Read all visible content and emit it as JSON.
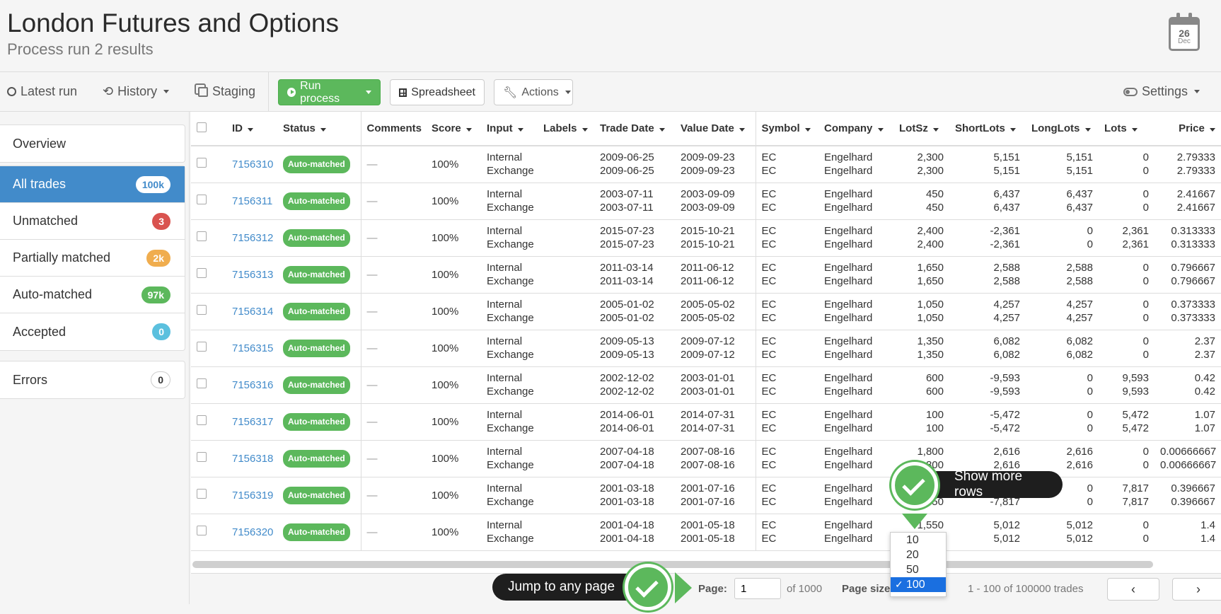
{
  "header": {
    "title": "London Futures and Options",
    "subtitle": "Process run 2 results",
    "calendar": {
      "day": "26",
      "month": "Dec"
    }
  },
  "toolbar": {
    "latest_run": "Latest run",
    "history": "History",
    "staging": "Staging",
    "run_process": "Run process",
    "spreadsheet": "Spreadsheet",
    "actions": "Actions",
    "settings": "Settings"
  },
  "sidebar": {
    "overview": "Overview",
    "items": [
      {
        "label": "All trades",
        "count": "100k",
        "color": "#ffffff",
        "active": true
      },
      {
        "label": "Unmatched",
        "count": "3",
        "color": "#d9534f"
      },
      {
        "label": "Partially matched",
        "count": "2k",
        "color": "#f0ad4e"
      },
      {
        "label": "Auto-matched",
        "count": "97k",
        "color": "#5cb85c"
      },
      {
        "label": "Accepted",
        "count": "0",
        "color": "#5bc0de"
      }
    ],
    "errors": {
      "label": "Errors",
      "count": "0"
    }
  },
  "table": {
    "headers": {
      "id": "ID",
      "status": "Status",
      "comments": "Comments",
      "score": "Score",
      "input": "Input",
      "labels": "Labels",
      "trade_date": "Trade Date",
      "value_date": "Value Date",
      "symbol": "Symbol",
      "company": "Company",
      "lotsz": "LotSz",
      "shortlots": "ShortLots",
      "longlots": "LongLots",
      "lots": "Lots",
      "price": "Price"
    },
    "rows": [
      {
        "id": "7156310",
        "status": "Auto-matched",
        "comments": "—",
        "score": "100%",
        "input": [
          "Internal",
          "Exchange"
        ],
        "trade_date": [
          "2009-06-25",
          "2009-06-25"
        ],
        "value_date": [
          "2009-09-23",
          "2009-09-23"
        ],
        "symbol": [
          "EC",
          "EC"
        ],
        "company": [
          "Engelhard",
          "Engelhard"
        ],
        "lotsz": [
          "2,300",
          "2,300"
        ],
        "shortlots": [
          "5,151",
          "5,151"
        ],
        "longlots": [
          "5,151",
          "5,151"
        ],
        "lots": [
          "0",
          "0"
        ],
        "price": [
          "2.79333",
          "2.79333"
        ]
      },
      {
        "id": "7156311",
        "status": "Auto-matched",
        "comments": "—",
        "score": "100%",
        "input": [
          "Internal",
          "Exchange"
        ],
        "trade_date": [
          "2003-07-11",
          "2003-07-11"
        ],
        "value_date": [
          "2003-09-09",
          "2003-09-09"
        ],
        "symbol": [
          "EC",
          "EC"
        ],
        "company": [
          "Engelhard",
          "Engelhard"
        ],
        "lotsz": [
          "450",
          "450"
        ],
        "shortlots": [
          "6,437",
          "6,437"
        ],
        "longlots": [
          "6,437",
          "6,437"
        ],
        "lots": [
          "0",
          "0"
        ],
        "price": [
          "2.41667",
          "2.41667"
        ]
      },
      {
        "id": "7156312",
        "status": "Auto-matched",
        "comments": "—",
        "score": "100%",
        "input": [
          "Internal",
          "Exchange"
        ],
        "trade_date": [
          "2015-07-23",
          "2015-07-23"
        ],
        "value_date": [
          "2015-10-21",
          "2015-10-21"
        ],
        "symbol": [
          "EC",
          "EC"
        ],
        "company": [
          "Engelhard",
          "Engelhard"
        ],
        "lotsz": [
          "2,400",
          "2,400"
        ],
        "shortlots": [
          "-2,361",
          "-2,361"
        ],
        "longlots": [
          "0",
          "0"
        ],
        "lots": [
          "2,361",
          "2,361"
        ],
        "price": [
          "0.313333",
          "0.313333"
        ]
      },
      {
        "id": "7156313",
        "status": "Auto-matched",
        "comments": "—",
        "score": "100%",
        "input": [
          "Internal",
          "Exchange"
        ],
        "trade_date": [
          "2011-03-14",
          "2011-03-14"
        ],
        "value_date": [
          "2011-06-12",
          "2011-06-12"
        ],
        "symbol": [
          "EC",
          "EC"
        ],
        "company": [
          "Engelhard",
          "Engelhard"
        ],
        "lotsz": [
          "1,650",
          "1,650"
        ],
        "shortlots": [
          "2,588",
          "2,588"
        ],
        "longlots": [
          "2,588",
          "2,588"
        ],
        "lots": [
          "0",
          "0"
        ],
        "price": [
          "0.796667",
          "0.796667"
        ]
      },
      {
        "id": "7156314",
        "status": "Auto-matched",
        "comments": "—",
        "score": "100%",
        "input": [
          "Internal",
          "Exchange"
        ],
        "trade_date": [
          "2005-01-02",
          "2005-01-02"
        ],
        "value_date": [
          "2005-05-02",
          "2005-05-02"
        ],
        "symbol": [
          "EC",
          "EC"
        ],
        "company": [
          "Engelhard",
          "Engelhard"
        ],
        "lotsz": [
          "1,050",
          "1,050"
        ],
        "shortlots": [
          "4,257",
          "4,257"
        ],
        "longlots": [
          "4,257",
          "4,257"
        ],
        "lots": [
          "0",
          "0"
        ],
        "price": [
          "0.373333",
          "0.373333"
        ]
      },
      {
        "id": "7156315",
        "status": "Auto-matched",
        "comments": "—",
        "score": "100%",
        "input": [
          "Internal",
          "Exchange"
        ],
        "trade_date": [
          "2009-05-13",
          "2009-05-13"
        ],
        "value_date": [
          "2009-07-12",
          "2009-07-12"
        ],
        "symbol": [
          "EC",
          "EC"
        ],
        "company": [
          "Engelhard",
          "Engelhard"
        ],
        "lotsz": [
          "1,350",
          "1,350"
        ],
        "shortlots": [
          "6,082",
          "6,082"
        ],
        "longlots": [
          "6,082",
          "6,082"
        ],
        "lots": [
          "0",
          "0"
        ],
        "price": [
          "2.37",
          "2.37"
        ]
      },
      {
        "id": "7156316",
        "status": "Auto-matched",
        "comments": "—",
        "score": "100%",
        "input": [
          "Internal",
          "Exchange"
        ],
        "trade_date": [
          "2002-12-02",
          "2002-12-02"
        ],
        "value_date": [
          "2003-01-01",
          "2003-01-01"
        ],
        "symbol": [
          "EC",
          "EC"
        ],
        "company": [
          "Engelhard",
          "Engelhard"
        ],
        "lotsz": [
          "600",
          "600"
        ],
        "shortlots": [
          "-9,593",
          "-9,593"
        ],
        "longlots": [
          "0",
          "0"
        ],
        "lots": [
          "9,593",
          "9,593"
        ],
        "price": [
          "0.42",
          "0.42"
        ]
      },
      {
        "id": "7156317",
        "status": "Auto-matched",
        "comments": "—",
        "score": "100%",
        "input": [
          "Internal",
          "Exchange"
        ],
        "trade_date": [
          "2014-06-01",
          "2014-06-01"
        ],
        "value_date": [
          "2014-07-31",
          "2014-07-31"
        ],
        "symbol": [
          "EC",
          "EC"
        ],
        "company": [
          "Engelhard",
          "Engelhard"
        ],
        "lotsz": [
          "100",
          "100"
        ],
        "shortlots": [
          "-5,472",
          "-5,472"
        ],
        "longlots": [
          "0",
          "0"
        ],
        "lots": [
          "5,472",
          "5,472"
        ],
        "price": [
          "1.07",
          "1.07"
        ]
      },
      {
        "id": "7156318",
        "status": "Auto-matched",
        "comments": "—",
        "score": "100%",
        "input": [
          "Internal",
          "Exchange"
        ],
        "trade_date": [
          "2007-04-18",
          "2007-04-18"
        ],
        "value_date": [
          "2007-08-16",
          "2007-08-16"
        ],
        "symbol": [
          "EC",
          "EC"
        ],
        "company": [
          "Engelhard",
          "Engelhard"
        ],
        "lotsz": [
          "1,800",
          "1,800"
        ],
        "shortlots": [
          "2,616",
          "2,616"
        ],
        "longlots": [
          "2,616",
          "2,616"
        ],
        "lots": [
          "0",
          "0"
        ],
        "price": [
          "0.00666667",
          "0.00666667"
        ]
      },
      {
        "id": "7156319",
        "status": "Auto-matched",
        "comments": "—",
        "score": "100%",
        "input": [
          "Internal",
          "Exchange"
        ],
        "trade_date": [
          "2001-03-18",
          "2001-03-18"
        ],
        "value_date": [
          "2001-07-16",
          "2001-07-16"
        ],
        "symbol": [
          "EC",
          "EC"
        ],
        "company": [
          "Engelhard",
          "Engelhard"
        ],
        "lotsz": [
          "650",
          "650"
        ],
        "shortlots": [
          "-7,817",
          "-7,817"
        ],
        "longlots": [
          "0",
          "0"
        ],
        "lots": [
          "7,817",
          "7,817"
        ],
        "price": [
          "0.396667",
          "0.396667"
        ]
      },
      {
        "id": "7156320",
        "status": "Auto-matched",
        "comments": "—",
        "score": "100%",
        "input": [
          "Internal",
          "Exchange"
        ],
        "trade_date": [
          "2001-04-18",
          "2001-04-18"
        ],
        "value_date": [
          "2001-05-18",
          "2001-05-18"
        ],
        "symbol": [
          "EC",
          "EC"
        ],
        "company": [
          "Engelhard",
          "Engelhard"
        ],
        "lotsz": [
          "1,550",
          "1,550"
        ],
        "shortlots": [
          "5,012",
          "5,012"
        ],
        "longlots": [
          "5,012",
          "5,012"
        ],
        "lots": [
          "0",
          "0"
        ],
        "price": [
          "1.4",
          "1.4"
        ]
      }
    ]
  },
  "footer": {
    "page_label": "Page:",
    "page_value": "1",
    "of_pages": "of 1000",
    "page_size_label": "Page size",
    "range": "1 - 100 of 100000 trades"
  },
  "page_size_options": [
    "10",
    "20",
    "50",
    "100"
  ],
  "page_size_selected": "100",
  "tips": {
    "show_more_rows": "Show more rows",
    "jump_to_page": "Jump to any page"
  },
  "colors": {
    "primary": "#428bca",
    "success": "#5cb85c",
    "danger": "#d9534f",
    "warning": "#f0ad4e",
    "info": "#5bc0de"
  }
}
